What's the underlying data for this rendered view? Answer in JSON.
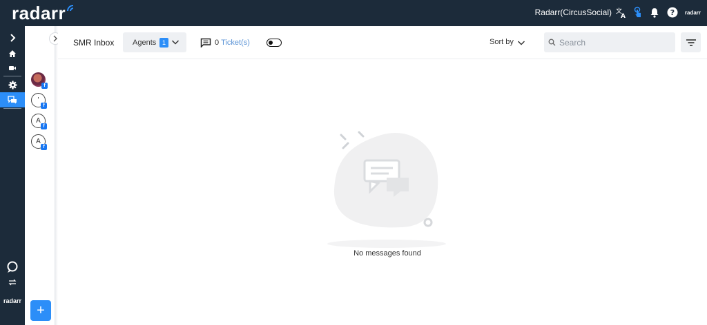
{
  "app": {
    "logo": "radarr",
    "mini_logo": "radarr",
    "account_name": "Radarr(CircusSocial)"
  },
  "topbar_icons": [
    "translate-icon",
    "touch-icon",
    "bell-icon",
    "help-icon"
  ],
  "rail": {
    "items": [
      "chevron-right-icon",
      "home-icon",
      "video-icon",
      "settings-icon",
      "chat-icon"
    ],
    "active": "chat-icon",
    "bottom_icons": [
      "support-chat-icon",
      "switch-icon"
    ],
    "logo": "radarr"
  },
  "contacts": {
    "avatars": [
      {
        "kind": "photo",
        "initial": "",
        "channel": "facebook"
      },
      {
        "kind": "initial",
        "initial": "'",
        "channel": "facebook"
      },
      {
        "kind": "initial",
        "initial": "A",
        "channel": "facebook"
      },
      {
        "kind": "initial",
        "initial": "A",
        "channel": "facebook"
      }
    ],
    "add_button": "+"
  },
  "header": {
    "title": "SMR Inbox",
    "agents_label": "Agents",
    "agents_count": "1",
    "ticket_count": "0",
    "ticket_label": "Ticket(s)",
    "toggle_on": false,
    "sort_label": "Sort by",
    "search_placeholder": "Search"
  },
  "empty_state": {
    "message": "No messages found"
  },
  "colors": {
    "topbar": "#1c2b3a",
    "accent": "#2c8ef8",
    "facebook": "#1877f2"
  }
}
